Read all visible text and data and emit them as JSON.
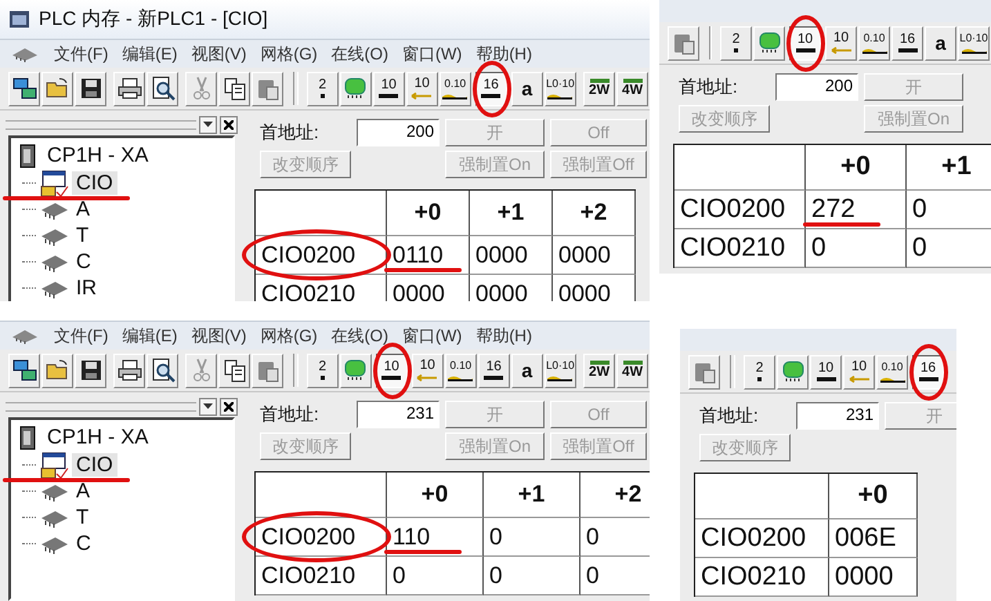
{
  "panels": [
    {
      "title": "PLC 内存 - 新PLC1 - [CIO]",
      "menu": [
        "文件(F)",
        "编辑(E)",
        "视图(V)",
        "网格(G)",
        "在线(O)",
        "窗口(W)",
        "帮助(H)"
      ],
      "toolbar": [
        {
          "kind": "new",
          "selected": false
        },
        {
          "kind": "open",
          "selected": false
        },
        {
          "kind": "save",
          "selected": false
        },
        {
          "kind": "spacer"
        },
        {
          "kind": "print",
          "selected": false
        },
        {
          "kind": "preview",
          "selected": false
        },
        {
          "kind": "spacer"
        },
        {
          "kind": "cut",
          "selected": false
        },
        {
          "kind": "copy",
          "selected": false
        },
        {
          "kind": "paste",
          "selected": false
        },
        {
          "kind": "separator"
        },
        {
          "kind": "num-dot",
          "label": "2",
          "selected": false
        },
        {
          "kind": "chip",
          "selected": false
        },
        {
          "kind": "num-bar",
          "label": "10",
          "selected": false
        },
        {
          "kind": "num-arrow",
          "label": "10",
          "selected": false
        },
        {
          "kind": "num-wave",
          "label": "0.10",
          "selected": false
        },
        {
          "kind": "num-bar",
          "label": "16",
          "selected": true
        },
        {
          "kind": "letter",
          "label": "a",
          "selected": false
        },
        {
          "kind": "num-wave",
          "label": "L0·10",
          "selected": false
        },
        {
          "kind": "spacer"
        },
        {
          "kind": "num-dots",
          "label": "2W",
          "selected": false
        },
        {
          "kind": "num-dots",
          "label": "4W",
          "selected": false
        }
      ],
      "tree": {
        "root": "CP1H - XA",
        "children": [
          {
            "label": "CIO",
            "kind": "monitor",
            "selected": true,
            "underlined": true
          },
          {
            "label": "A",
            "kind": "chip",
            "selected": false,
            "underlined": false
          },
          {
            "label": "T",
            "kind": "chip",
            "selected": false,
            "underlined": false
          },
          {
            "label": "C",
            "kind": "chip",
            "selected": false,
            "underlined": false
          },
          {
            "label": "IR",
            "kind": "chip",
            "selected": false,
            "underlined": false
          }
        ]
      },
      "form": {
        "label": "首地址:",
        "address": "200",
        "top": [
          {
            "label": "开",
            "disabled": true
          },
          {
            "label": "Off",
            "disabled": true
          }
        ],
        "reorder": {
          "label": "改变顺序",
          "disabled": true
        },
        "bottom": [
          {
            "label": "强制置On",
            "disabled": true
          },
          {
            "label": "强制置Off",
            "disabled": true
          }
        ]
      },
      "grid": {
        "columns": [
          "+0",
          "+1",
          "+2"
        ],
        "rows": [
          {
            "label": "CIO0200",
            "circled": true,
            "cells": [
              {
                "value": "0110",
                "underlined": true
              },
              {
                "value": "0000",
                "underlined": false
              },
              {
                "value": "0000",
                "underlined": false
              }
            ]
          },
          {
            "label": "CIO0210",
            "circled": false,
            "cells": [
              {
                "value": "0000"
              },
              {
                "value": "0000"
              },
              {
                "value": "0000"
              }
            ]
          }
        ]
      }
    },
    {
      "toolbar": [
        {
          "kind": "paste",
          "selected": false
        },
        {
          "kind": "separator"
        },
        {
          "kind": "num-dot",
          "label": "2",
          "selected": false
        },
        {
          "kind": "chip",
          "selected": false
        },
        {
          "kind": "num-bar",
          "label": "10",
          "selected": true
        },
        {
          "kind": "num-arrow",
          "label": "10",
          "selected": false
        },
        {
          "kind": "num-wave",
          "label": "0.10",
          "selected": false
        },
        {
          "kind": "num-bar",
          "label": "16",
          "selected": false
        },
        {
          "kind": "letter",
          "label": "a",
          "selected": false
        },
        {
          "kind": "num-wave",
          "label": "L0·10",
          "selected": false
        }
      ],
      "form": {
        "label": "首地址:",
        "address": "200",
        "top": [
          {
            "label": "开",
            "disabled": true
          }
        ],
        "reorder": {
          "label": "改变顺序",
          "disabled": true
        },
        "bottom": [
          {
            "label": "强制置On",
            "disabled": true
          }
        ]
      },
      "grid": {
        "columns": [
          "+0",
          "+1"
        ],
        "rows": [
          {
            "label": "CIO0200",
            "circled": false,
            "cells": [
              {
                "value": "272",
                "underlined": true
              },
              {
                "value": "0",
                "underlined": false
              }
            ]
          },
          {
            "label": "CIO0210",
            "circled": false,
            "cells": [
              {
                "value": "0",
                "underlined": false
              },
              {
                "value": "0",
                "underlined": false
              }
            ]
          }
        ]
      }
    },
    {
      "menu": [
        "文件(F)",
        "编辑(E)",
        "视图(V)",
        "网格(G)",
        "在线(O)",
        "窗口(W)",
        "帮助(H)"
      ],
      "toolbar": [
        {
          "kind": "new",
          "selected": false
        },
        {
          "kind": "open",
          "selected": false
        },
        {
          "kind": "save",
          "selected": false
        },
        {
          "kind": "spacer"
        },
        {
          "kind": "print",
          "selected": false
        },
        {
          "kind": "preview",
          "selected": false
        },
        {
          "kind": "spacer"
        },
        {
          "kind": "cut",
          "selected": false
        },
        {
          "kind": "copy",
          "selected": false
        },
        {
          "kind": "paste",
          "selected": false
        },
        {
          "kind": "separator"
        },
        {
          "kind": "num-dot",
          "label": "2",
          "selected": false
        },
        {
          "kind": "chip",
          "selected": false
        },
        {
          "kind": "num-bar",
          "label": "10",
          "selected": true
        },
        {
          "kind": "num-arrow",
          "label": "10",
          "selected": false
        },
        {
          "kind": "num-wave",
          "label": "0.10",
          "selected": false
        },
        {
          "kind": "num-bar",
          "label": "16",
          "selected": false
        },
        {
          "kind": "letter",
          "label": "a",
          "selected": false
        },
        {
          "kind": "num-wave",
          "label": "L0·10",
          "selected": false
        },
        {
          "kind": "spacer"
        },
        {
          "kind": "num-dots",
          "label": "2W",
          "selected": false
        },
        {
          "kind": "num-dots",
          "label": "4W",
          "selected": false
        }
      ],
      "tree": {
        "root": "CP1H - XA",
        "children": [
          {
            "label": "CIO",
            "kind": "monitor",
            "selected": true,
            "underlined": true
          },
          {
            "label": "A",
            "kind": "chip",
            "selected": false,
            "underlined": false
          },
          {
            "label": "T",
            "kind": "chip",
            "selected": false,
            "underlined": false
          },
          {
            "label": "C",
            "kind": "chip",
            "selected": false,
            "underlined": false
          }
        ]
      },
      "form": {
        "label": "首地址:",
        "address": "231",
        "top": [
          {
            "label": "开",
            "disabled": true
          },
          {
            "label": "Off",
            "disabled": true
          }
        ],
        "reorder": {
          "label": "改变顺序",
          "disabled": true
        },
        "bottom": [
          {
            "label": "强制置On",
            "disabled": true
          },
          {
            "label": "强制置Off",
            "disabled": true
          }
        ]
      },
      "grid": {
        "columns": [
          "+0",
          "+1",
          "+2"
        ],
        "rows": [
          {
            "label": "CIO0200",
            "circled": true,
            "cells": [
              {
                "value": "110",
                "underlined": true
              },
              {
                "value": "0",
                "underlined": false
              },
              {
                "value": "0",
                "underlined": false
              }
            ]
          },
          {
            "label": "CIO0210",
            "circled": false,
            "cells": [
              {
                "value": "0",
                "underlined": false
              },
              {
                "value": "0",
                "underlined": false
              },
              {
                "value": "0",
                "underlined": false
              }
            ]
          }
        ]
      }
    },
    {
      "toolbar": [
        {
          "kind": "paste",
          "selected": false
        },
        {
          "kind": "separator"
        },
        {
          "kind": "num-dot",
          "label": "2",
          "selected": false
        },
        {
          "kind": "chip",
          "selected": false
        },
        {
          "kind": "num-bar",
          "label": "10",
          "selected": false
        },
        {
          "kind": "num-arrow",
          "label": "10",
          "selected": false
        },
        {
          "kind": "num-wave",
          "label": "0.10",
          "selected": false
        },
        {
          "kind": "num-bar",
          "label": "16",
          "selected": true
        }
      ],
      "form": {
        "label": "首地址:",
        "address": "231",
        "top": [
          {
            "label": "开",
            "disabled": true
          }
        ],
        "reorder": {
          "label": "改变顺序",
          "disabled": true
        }
      },
      "grid": {
        "columns": [
          "+0"
        ],
        "rows": [
          {
            "label": "CIO0200",
            "circled": false,
            "cells": [
              {
                "value": "006E",
                "underlined": false
              }
            ]
          },
          {
            "label": "CIO0210",
            "circled": false,
            "cells": [
              {
                "value": "0000",
                "underlined": false
              }
            ]
          }
        ]
      }
    }
  ]
}
